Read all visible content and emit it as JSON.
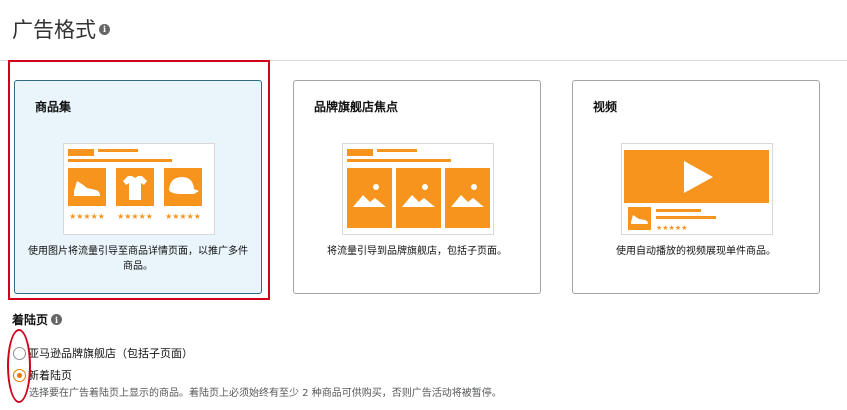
{
  "section_title": "广告格式",
  "info_glyph": "i",
  "cards": [
    {
      "title": "商品集",
      "description": "使用图片将流量引导至商品详情页面，以推广多件商品。"
    },
    {
      "title": "品牌旗舰店焦点",
      "description": "将流量引导到品牌旗舰店，包括子页面。"
    },
    {
      "title": "视频",
      "description": "使用自动播放的视频展现单件商品。"
    }
  ],
  "selected_card": 0,
  "stars": "★★★★★",
  "landing": {
    "title": "着陆页",
    "options": [
      {
        "label": "亚马逊品牌旗舰店（包括子页面）",
        "checked": false
      },
      {
        "label": "新着陆页",
        "checked": true
      }
    ],
    "hint": "选择要在广告着陆页上显示的商品。着陆页上必须始终有至少 2 种商品可供购买，否则广告活动将被暂停。"
  },
  "colors": {
    "accent_orange": "#f7941d",
    "selected_bg": "#e9f4fb",
    "selected_border": "#2e6a84",
    "annotation_red": "#d0021b"
  },
  "icons": [
    "info-icon",
    "shoe-icon",
    "tshirt-icon",
    "cap-icon",
    "image-icon",
    "play-icon"
  ]
}
